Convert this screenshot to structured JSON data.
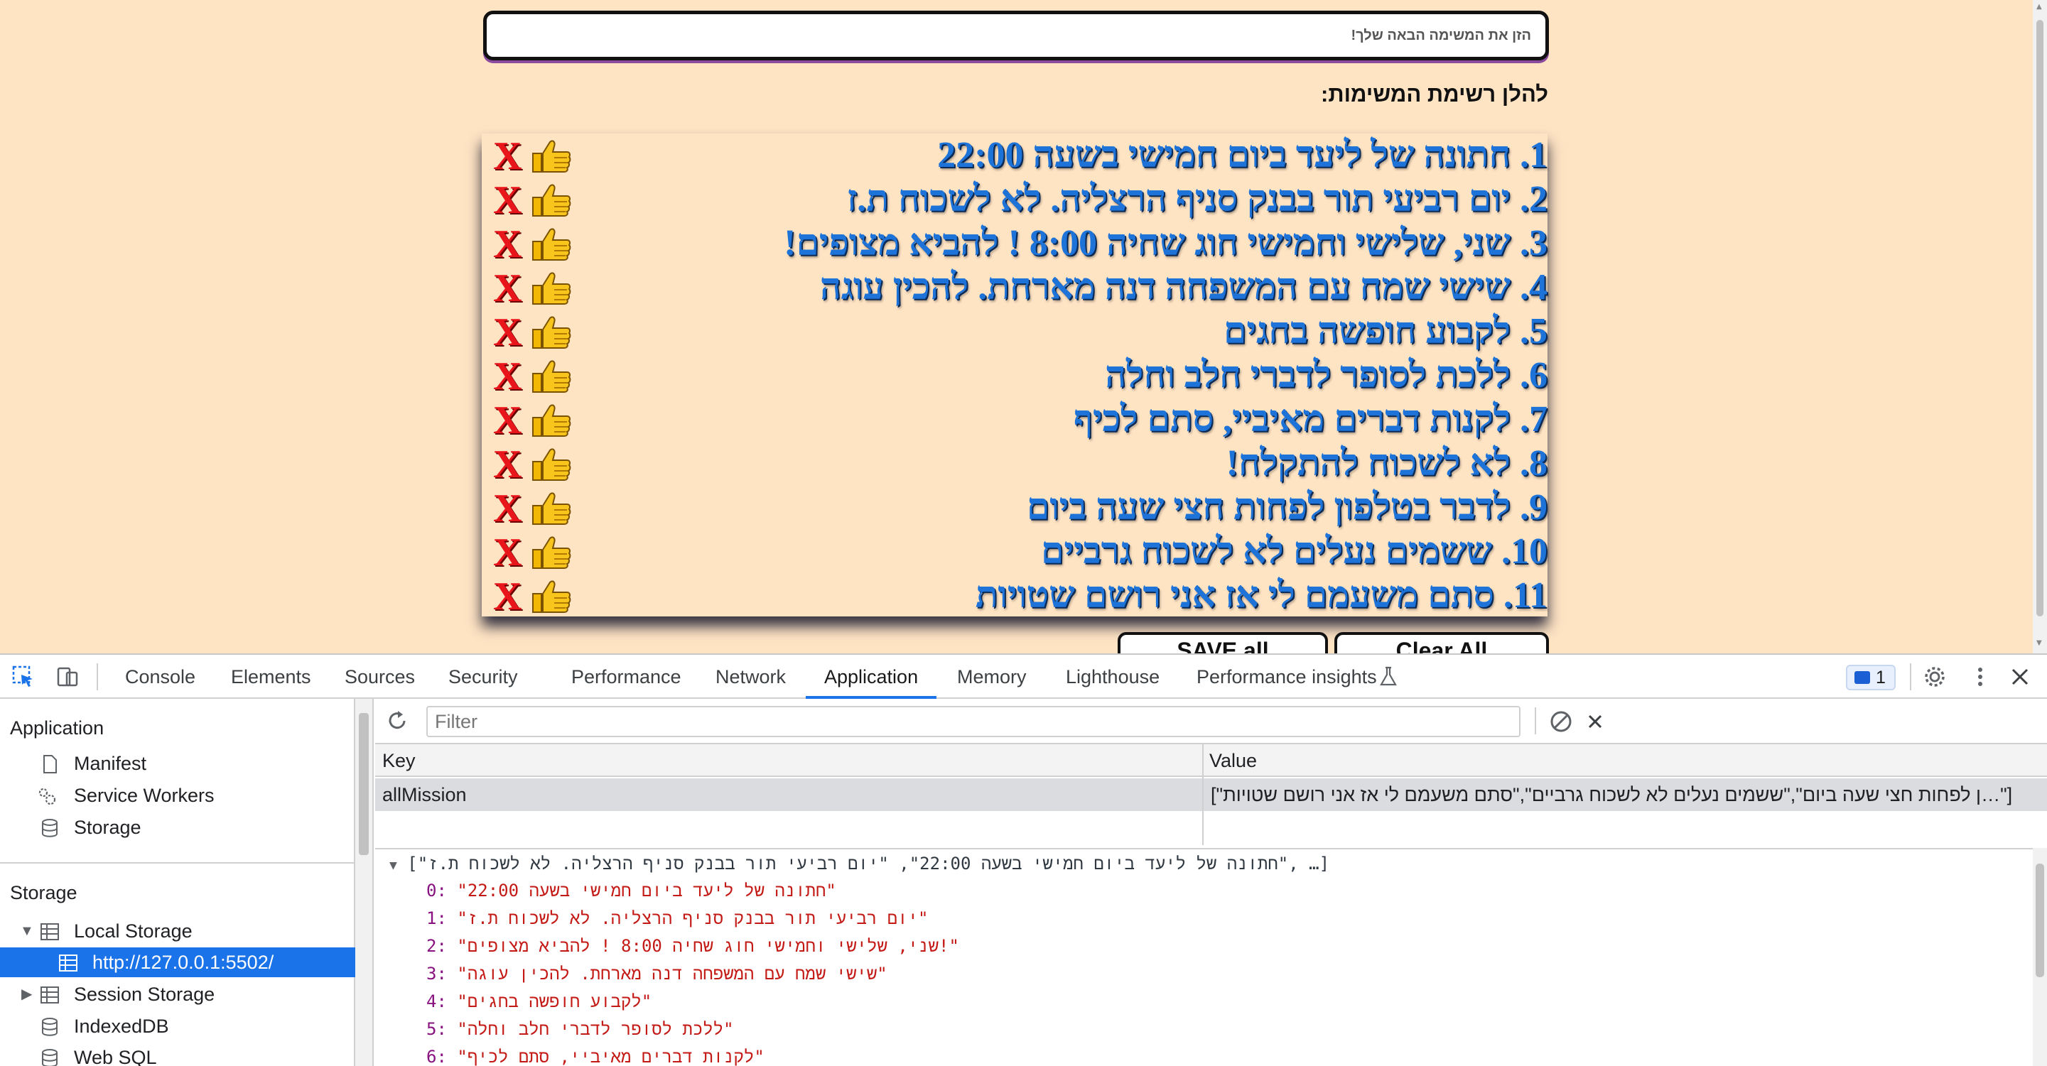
{
  "page": {
    "task_input_placeholder": "הזן את המשימה הבאה שלך!",
    "list_heading": "להלן רשימת המשימות:",
    "tasks": [
      "1. חתונה של ליעד ביום חמישי בשעה 22:00",
      "2. יום רביעי תור בבנק סניף הרצליה. לא לשכוח ת.ז",
      "3. שני, שלישי וחמישי חוג שחיה 8:00 ! להביא מצופים!",
      "4. שישי שמח עם המשפחה דנה מארחת. להכין עוגה",
      "5. לקבוע חופשה בחגים",
      "6. ללכת לסופר לדברי חלב וחלה",
      "7. לקנות דברים מאיביי, סתם לכיף",
      "8. לא לשכוח להתקלח!",
      "9. לדבר בטלפון לפחות חצי שעה ביום",
      "10. ששמים נעלים לא לשכוח גרביים",
      "11. סתם משעמם לי אז אני רושם שטויות"
    ],
    "delete_label": "X",
    "save_label": "SAVE all",
    "clear_label": "Clear All"
  },
  "devtools": {
    "tabs": [
      "Console",
      "Elements",
      "Sources",
      "Security",
      "Performance",
      "Network",
      "Application",
      "Memory",
      "Lighthouse",
      "Performance insights"
    ],
    "active_tab": "Application",
    "issues_count": "1",
    "sidebar": {
      "application_header": "Application",
      "application_items": [
        "Manifest",
        "Service Workers",
        "Storage"
      ],
      "storage_header": "Storage",
      "local_storage": "Local Storage",
      "origin": "http://127.0.0.1:5502/",
      "storage_items": [
        "Session Storage",
        "IndexedDB",
        "Web SQL"
      ]
    },
    "filter_placeholder": "Filter",
    "table": {
      "key_header": "Key",
      "value_header": "Value",
      "row_key": "allMission",
      "row_value": "[\"…ן לפחות חצי שעה ביום\",\"ששמים נעלים לא לשכוח גרביים\",\"סתם משעמם לי אז אני רושם שטויות\"]"
    },
    "preview": {
      "header": "[\"חתונה של ליעד ביום חמישי בשעה 22:00\", \"יום רביעי תור בבנק סניף הרצליה. לא לשכוח ת.ז\", …]",
      "items": [
        {
          "idx": "0:",
          "val": "\"חתונה של ליעד ביום חמישי בשעה 22:00\""
        },
        {
          "idx": "1:",
          "val": "\"יום רביעי תור בבנק סניף הרצליה. לא לשכוח ת.ז\""
        },
        {
          "idx": "2:",
          "val": "\"שני, שלישי וחמישי חוג שחיה 8:00 ! להביא מצופים!\""
        },
        {
          "idx": "3:",
          "val": "\"שישי שמח עם המשפחה דנה מארחת. להכין עוגה\""
        },
        {
          "idx": "4:",
          "val": "\"לקבוע חופשה בחגים\""
        },
        {
          "idx": "5:",
          "val": "\"ללכת לסופר לדברי חלב וחלה\""
        },
        {
          "idx": "6:",
          "val": "\"לקנות דברים מאיביי, סתם לכיף\""
        }
      ]
    }
  }
}
